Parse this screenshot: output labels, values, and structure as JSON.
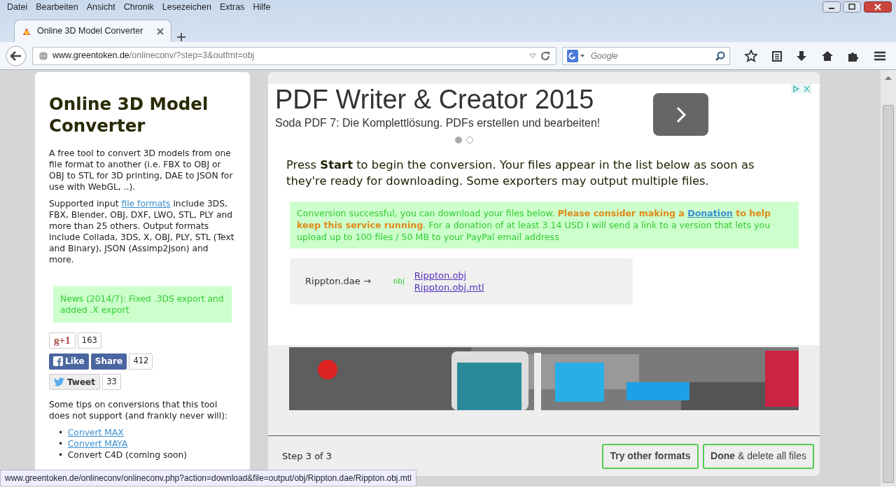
{
  "menu": [
    "Datei",
    "Bearbeiten",
    "Ansicht",
    "Chronik",
    "Lesezeichen",
    "Extras",
    "Hilfe"
  ],
  "tabs": [
    {
      "title": "Online 3D Model Converter",
      "selected": true
    }
  ],
  "address_bar": {
    "host": "www.greentoken.de",
    "path": "/onlineconv/?step=3&outfmt=obj"
  },
  "search": {
    "placeholder": "Google"
  },
  "sidebar": {
    "title": "Online 3D Model Converter",
    "paragraphs": [
      [
        {
          "text": "A free tool to convert 3D models from one file format to another (i.e. FBX to OBJ or OBJ to STL for 3D printing, DAE to JSON for use with WebGL, ..).",
          "kind": "text"
        }
      ],
      [
        {
          "text": "Supported input ",
          "kind": "text"
        },
        {
          "text": "file formats",
          "kind": "link"
        },
        {
          "text": " include 3DS, FBX, Blender, OBJ, DXF, LWO, STL, PLY and more than 25 others. Output formats include Collada, 3DS, X, OBJ, PLY, STL (Text and Binary), JSON (Assimp2Json) and more.",
          "kind": "text"
        }
      ]
    ],
    "news": "News (2014/7): Fixed .3DS export and added .X export",
    "social": [
      {
        "kind": "gplus",
        "label": "g+1",
        "count": "163"
      },
      {
        "kind": "facebook",
        "label": "Like",
        "share": "Share",
        "count": "412"
      },
      {
        "kind": "twitter",
        "label": "Tweet",
        "count": "33"
      }
    ],
    "tips": "Some tips on conversions that this tool does not support (and frankly never will):",
    "tip_items": [
      {
        "marker": "•",
        "text": "Convert MAX",
        "kind": "link"
      },
      {
        "marker": "•",
        "text": "Convert MAYA",
        "kind": "link"
      },
      {
        "marker": "•",
        "text": "Convert C4D (coming soon)",
        "kind": "text"
      }
    ]
  },
  "ad": {
    "title": "PDF Writer & Creator 2015",
    "subtitle": "Soda PDF 7: Die Komplettlösung. PDFs erstellen und bearbeiten!",
    "dots": [
      {
        "selected": true
      },
      {
        "selected": false
      }
    ]
  },
  "instructions": "Press **Start** to begin the conversion. Your files appear in the list below as soon as they're ready for downloading. Some exporters may output multiple files.",
  "alert": [
    {
      "text": "Conversion successful, you can download your files below. ",
      "kind": "text"
    },
    {
      "text": "Please consider making a ",
      "kind": "emphasis"
    },
    {
      "text": "Donation",
      "kind": "link"
    },
    {
      "text": " to help keep this service running",
      "kind": "emphasis"
    },
    {
      "text": ". For a donation of at least 3.14 USD I will send a link to a version that lets you upload up to 100 files / 50 MB to your PayPal email address",
      "kind": "text"
    }
  ],
  "result": {
    "source": "Rippton.dae →",
    "format": "obj",
    "files": [
      "Rippton.obj",
      "Rippton.obj.mtl"
    ]
  },
  "footer": {
    "step": "Step 3 of 3",
    "buttons": [
      "**Try other formats**",
      "**Done** & delete all files"
    ]
  },
  "status_bar": "www.greentoken.de/onlineconv/onlineconv.php?action=download&file=output/obj/Rippton.dae/Rippton.obj.mtl"
}
